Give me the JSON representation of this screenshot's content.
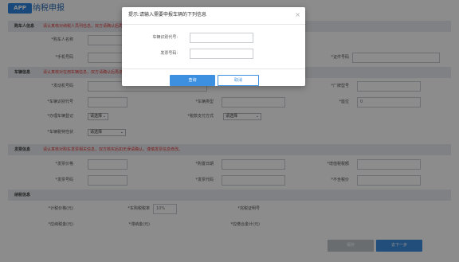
{
  "header": {
    "logo_text": "APP",
    "title": "纳税申报"
  },
  "sections": {
    "buyer": {
      "title": "购车人信息",
      "tip": "请认真核对纳税人员列信息，双方请确认后再进行填写申报。"
    },
    "vehicle": {
      "title": "车辆信息",
      "tip": "请认真核对在用车辆信息，双方请确认后再进行填写申报。"
    },
    "invoice": {
      "title": "发票信息",
      "tip": "请认真核对购车发票相关信息，双方核实后如无误请确认，谨慎发票信息修改。"
    },
    "tax": {
      "title": "纳税信息"
    }
  },
  "buyer_fields": {
    "name": "*购车人名称",
    "phone": "*手机号码",
    "id_no": "*证件号码"
  },
  "vehicle_fields": {
    "engine_no": "*发动机号码",
    "factory_model": "*厂牌型号",
    "vin": "*车辆识别代号",
    "vehicle_type": "*车辆类型",
    "seats": "*座位",
    "seats_value": "0",
    "fuel_register": "*办理车辆登记",
    "fuel_register_value": "请选择",
    "payment_method": "*税款支付方式",
    "payment_method_value": "请选择",
    "vehicle_purpose": "*车辆税特性状",
    "vehicle_purpose_value": "请选择"
  },
  "invoice_fields": {
    "price": "*发票价格",
    "date": "*购置日期",
    "tax_amount": "*增值税税额",
    "invoice_no": "*发票号码",
    "invoice_code": "*发票代码",
    "tax_free": "*不含税价"
  },
  "tax_fields": {
    "taxable_price": "*计税价格(元)",
    "tax_rate": "*车购税税率",
    "tax_rate_value": "10%",
    "tax_cert": "*完税证明号",
    "tax_due": "*应纳税金(元)",
    "late_fee": "*滞纳金(元)",
    "total": "*应缴合金计(元)"
  },
  "footer": {
    "secondary_button": "保存",
    "primary_button": "去下一步"
  },
  "modal": {
    "title": "提示:请输入需要申报车辆的下列信息",
    "close_glyph": "×",
    "vin_label": "车辆识别代号:",
    "invoice_label": "发票号码:",
    "confirm_label": "查询",
    "cancel_label": "取消"
  }
}
